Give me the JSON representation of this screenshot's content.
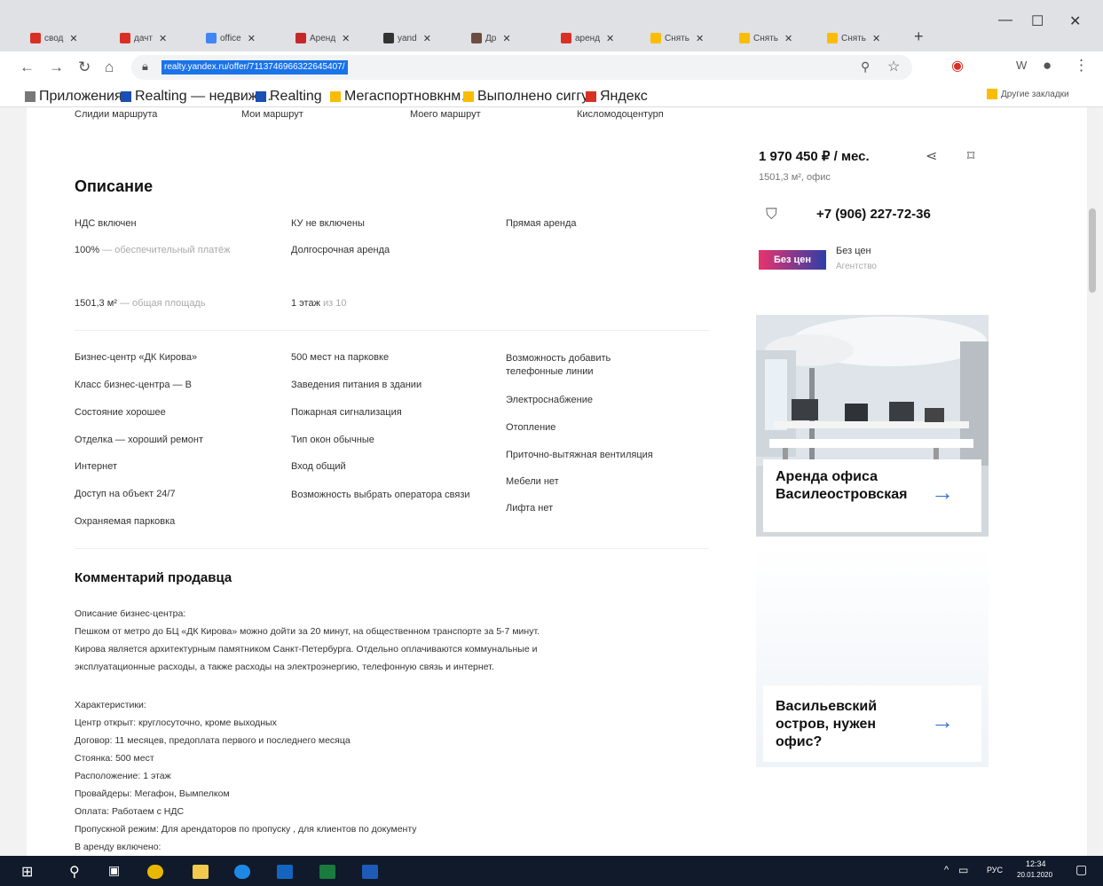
{
  "browser": {
    "tabs": [
      {
        "label": "свод",
        "color": "#d93025"
      },
      {
        "label": "дачт",
        "color": "#d93025"
      },
      {
        "label": "office",
        "color": "#4285f4"
      },
      {
        "label": "Аренд",
        "color": "#c62828"
      },
      {
        "label": "yand",
        "color": "#333333"
      },
      {
        "label": "Др",
        "color": "#6d4c41"
      },
      {
        "label": "аренд",
        "color": "#d93025"
      },
      {
        "label": "Снять",
        "color": "#fbbc04"
      },
      {
        "label": "Снять",
        "color": "#fbbc04"
      },
      {
        "label": "Снять",
        "color": "#fbbc04"
      }
    ],
    "new_tab": "+",
    "url": "realty.yandex.ru/offer/7113746966322645407/",
    "bookmarks": [
      {
        "label": "Приложения",
        "color": "#777777"
      },
      {
        "label": "Realting — недвиж…",
        "color": "#1a4fb5"
      },
      {
        "label": "Realting",
        "color": "#1a4fb5"
      },
      {
        "label": "Мегаспортновкнм…",
        "color": "#fbbc04"
      },
      {
        "label": "Выполнено сиггуг",
        "color": "#fbbc04"
      },
      {
        "label": "Яндекс",
        "color": "#d93025"
      }
    ],
    "bookmarks_other": "Другие закладки"
  },
  "listing": {
    "top_faint": [
      "Слидии маршрута",
      "Мои маршрут",
      "Моего маршрут",
      "Кисломодоцентурп"
    ],
    "description_title": "Описание",
    "features_row1": [
      "НДС включен",
      "КУ не включены",
      "Прямая аренда"
    ],
    "features_row2": [
      {
        "main": "100%",
        "sub": " — обеспечительный платёж"
      },
      {
        "main": "Долгосрочная аренда",
        "sub": ""
      }
    ],
    "area": {
      "main": "1501,3 м²",
      "sub": " — общая площадь"
    },
    "floor": {
      "main": "1 этаж",
      "sub": " из 10"
    },
    "col1": [
      "Бизнес-центр «ДК Кирова»",
      "Класс бизнес-центра — B",
      "Состояние хорошее",
      "Отделка — хороший ремонт",
      "Интернет",
      "Доступ на объект 24/7",
      "Охраняемая парковка"
    ],
    "col2": [
      "500 мест на парковке",
      "Заведения питания в здании",
      "Пожарная сигнализация",
      "Тип окон обычные",
      "Вход общий",
      "Возможность выбрать оператора связи"
    ],
    "col3": [
      "Возможность добавить телефонные линии",
      "Электроснабжение",
      "Отопление"
    ],
    "col3_faint": [
      "Приточно-вытяжная вентиляция",
      "Мебели нет",
      "Лифта нет"
    ],
    "comment_title": "Комментарий продавца",
    "comment_p1": [
      "Описание бизнес-центра:",
      "Пешком от метро до БЦ «ДК Кирова» можно дойти за 20 минут, на общественном транспорте за 5-7 минут.",
      "Кирова является архитектурным памятником Санкт-Петербурга. Отдельно оплачиваются коммунальные и",
      "эксплуатационные расходы, а также расходы на электроэнергию, телефонную связь и интернет."
    ],
    "comment_p2": [
      "Характеристики:",
      "Центр открыт: круглосуточно, кроме выходных",
      "Договор: 11 месяцев, предоплата первого и последнего месяца",
      "Стоянка: 500 мест",
      "Расположение: 1 этаж",
      "Провайдеры: Мегафон, Вымпелком",
      "Оплата: Работаем с НДС",
      "Пропускной режим: Для арендаторов по пропуску , для клиентов по документу",
      "В аренду включено:"
    ]
  },
  "sidebar": {
    "price": "1 970 450 ₽ / мес.",
    "price_sub": "1501,3 м², офис",
    "phone": "+7 (906) 227-72-36",
    "agency_logo": "Без цен",
    "agency_name": "Без цен",
    "agency_role": "Агентство",
    "ad1_title": "Аренда офиса Василеостровская",
    "ad2_title": "Васильевский остров, нужен офис?",
    "accent": "#3a6fd8"
  },
  "taskbar": {
    "lang": "РУС",
    "time": "12:34",
    "date": "20.01.2020"
  }
}
